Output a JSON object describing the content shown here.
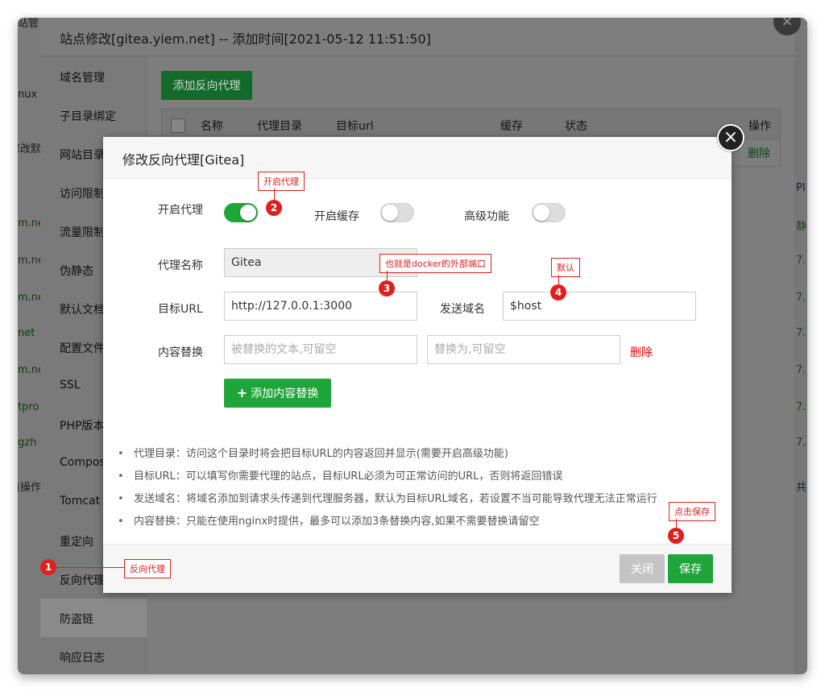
{
  "background": {
    "left_fragments": [
      "站管",
      "nux",
      "修改默",
      "m.ne",
      "m.ne",
      "m.ne",
      "net",
      "m.ne",
      "tpro",
      "gzh",
      "量操作"
    ],
    "right_fragments": [
      "PI",
      "静",
      "7.",
      "7.",
      "7.",
      "7.",
      "7.",
      "7.",
      "共"
    ]
  },
  "site_panel": {
    "title": "站点修改[gitea.yiem.net] -- 添加时间[2021-05-12 11:51:50]",
    "close_icon": "×",
    "menu": [
      "域名管理",
      "子目录绑定",
      "网站目录",
      "访问限制",
      "流量限制",
      "伪静态",
      "默认文档",
      "配置文件",
      "SSL",
      "PHP版本",
      "Composer",
      "Tomcat",
      "重定向",
      "反向代理",
      "防盗链",
      "响应日志"
    ],
    "add_proxy_label": "添加反向代理",
    "table_headers": [
      "名称",
      "代理目录",
      "目标url",
      "缓存",
      "状态",
      "操作"
    ],
    "row_delete": "删除"
  },
  "modal": {
    "title": "修改反向代理[Gitea]",
    "close_icon": "×",
    "enable_proxy_label": "开启代理",
    "enable_proxy_on": true,
    "enable_cache_label": "开启缓存",
    "enable_cache_on": false,
    "advanced_label": "高级功能",
    "advanced_on": false,
    "proxy_name_label": "代理名称",
    "proxy_name_value": "Gitea",
    "target_url_label": "目标URL",
    "target_url_value": "http://127.0.0.1:3000",
    "send_domain_label": "发送域名",
    "send_domain_value": "$host",
    "replace_label": "内容替换",
    "replace_from_placeholder": "被替换的文本,可留空",
    "replace_to_placeholder": "替换为,可留空",
    "replace_delete": "删除",
    "add_replace_label": "添加内容替换",
    "add_replace_icon": "+",
    "tips": [
      "代理目录：访问这个目录时将会把目标URL的内容返回并显示(需要开启高级功能)",
      "目标URL：可以填写你需要代理的站点，目标URL必须为可正常访问的URL，否则将返回错误",
      "发送域名：将域名添加到请求头传递到代理服务器，默认为目标URL域名，若设置不当可能导致代理无法正常运行",
      "内容替换：只能在使用nginx时提供，最多可以添加3条替换内容,如果不需要替换请留空"
    ],
    "close_button": "关闭",
    "save_button": "保存"
  },
  "annotations": [
    {
      "num": "1",
      "text": "反向代理"
    },
    {
      "num": "2",
      "text": "开启代理"
    },
    {
      "num": "3",
      "text": "也就是docker的外部端口"
    },
    {
      "num": "4",
      "text": "默认"
    },
    {
      "num": "5",
      "text": "点击保存"
    }
  ],
  "colors": {
    "accent": "#20a53a",
    "annotation": "#e02020"
  }
}
